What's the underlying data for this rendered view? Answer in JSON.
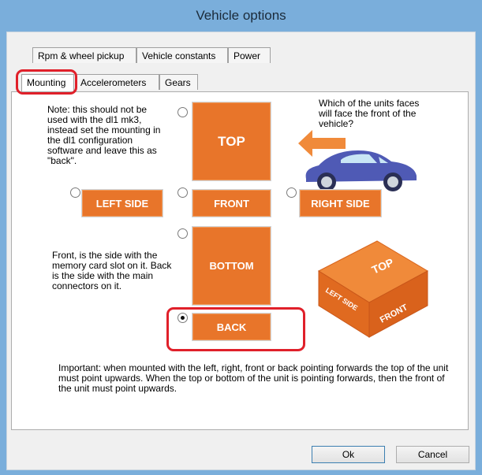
{
  "window": {
    "title": "Vehicle options"
  },
  "tabs_top": [
    "Rpm & wheel pickup",
    "Vehicle constants",
    "Power"
  ],
  "tabs_bottom": [
    "Mounting",
    "Accelerometers",
    "Gears"
  ],
  "note_text": "Note: this should not be used with the dl1 mk3, instead set the mounting in the dl1 configuration software and leave this as \"back\".",
  "question_text": "Which of the units faces will face the front of the vehicle?",
  "front_back_text": "Front, is the side with the memory card slot on it. Back is the side with the main connectors on it.",
  "important_text": "Important: when mounted with the left, right, front or back pointing forwards the top of the unit must point upwards. When the top or bottom of the unit is pointing forwards, then the front of the unit must point upwards.",
  "mount_buttons": {
    "top": "TOP",
    "left": "LEFT SIDE",
    "front": "FRONT",
    "right": "RIGHT SIDE",
    "bottom": "BOTTOM",
    "back": "BACK"
  },
  "selected_mount": "back",
  "cube_labels": {
    "top": "TOP",
    "left": "LEFT SIDE",
    "front": "FRONT"
  },
  "dialog_buttons": {
    "ok": "Ok",
    "cancel": "Cancel"
  },
  "colors": {
    "orange": "#e8752a",
    "car": "#4f5ab5",
    "arrow": "#f08a3a",
    "annotation": "#e0202a"
  }
}
